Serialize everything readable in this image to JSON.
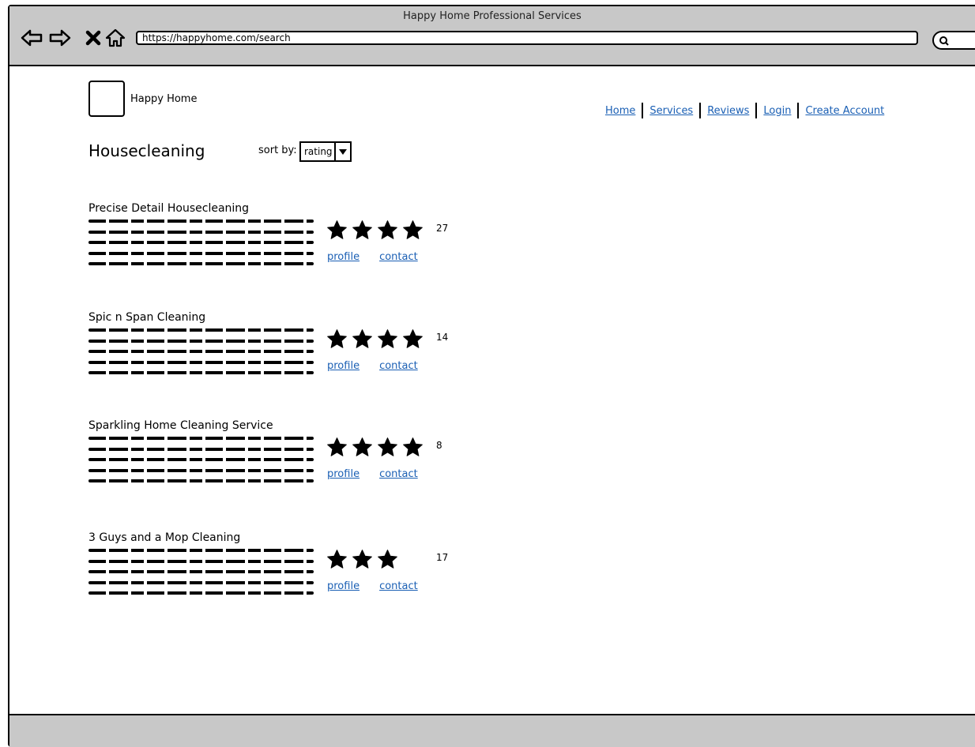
{
  "window": {
    "title": "Happy Home Professional Services"
  },
  "browser": {
    "url": "https://happyhome.com/search",
    "icons": [
      "back-arrow-icon",
      "forward-arrow-icon",
      "close-x-icon",
      "home-icon",
      "search-icon"
    ]
  },
  "site": {
    "name": "Happy Home"
  },
  "nav": {
    "items": [
      "Home",
      "Services",
      "Reviews",
      "Login",
      "Create Account"
    ]
  },
  "page": {
    "title": "Housecleaning",
    "sort_label": "sort by:",
    "sort_value": "rating"
  },
  "listings": [
    {
      "name": "Precise Detail Housecleaning",
      "stars": 4,
      "count": "27",
      "profile": "profile",
      "contact": "contact"
    },
    {
      "name": "Spic n Span Cleaning",
      "stars": 4,
      "count": "14",
      "profile": "profile",
      "contact": "contact"
    },
    {
      "name": "Sparkling Home Cleaning Service",
      "stars": 4,
      "count": "8",
      "profile": "profile",
      "contact": "contact"
    },
    {
      "name": "3 Guys and a Mop Cleaning",
      "stars": 3,
      "count": "17",
      "profile": "profile",
      "contact": "contact"
    }
  ],
  "colors": {
    "chrome": "#c8c8c8",
    "link": "#1a5fb4"
  }
}
